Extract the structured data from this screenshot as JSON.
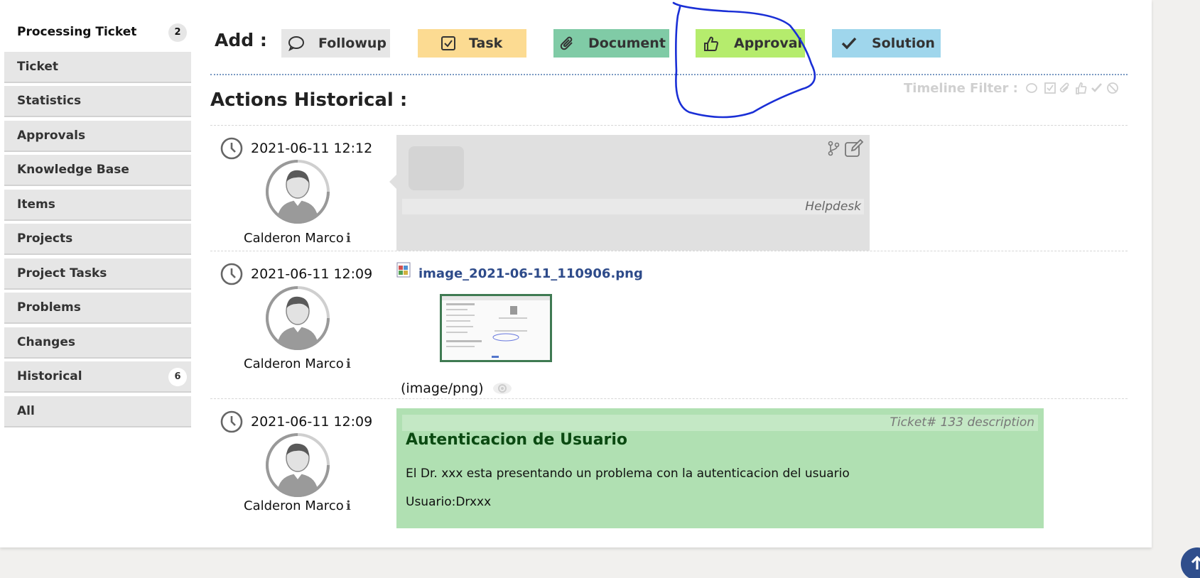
{
  "sidebar": {
    "items": [
      {
        "label": "Processing Ticket",
        "badge": "2"
      },
      {
        "label": "Ticket"
      },
      {
        "label": "Statistics"
      },
      {
        "label": "Approvals"
      },
      {
        "label": "Knowledge Base"
      },
      {
        "label": "Items"
      },
      {
        "label": "Projects"
      },
      {
        "label": "Project Tasks"
      },
      {
        "label": "Problems"
      },
      {
        "label": "Changes"
      },
      {
        "label": "Historical",
        "badge": "6"
      },
      {
        "label": "All"
      }
    ]
  },
  "add_bar": {
    "label": "Add :",
    "buttons": {
      "followup": "Followup",
      "task": "Task",
      "document": "Document",
      "approval": "Approval",
      "solution": "Solution"
    },
    "colors": {
      "followup": "#e6e6e6",
      "task": "#fcdb92",
      "document": "#80cba6",
      "approval": "#b5ec6d",
      "solution": "#9fd6ec"
    }
  },
  "timeline": {
    "title": "Actions Historical :",
    "filter_label": "Timeline Filter :",
    "filter_icons": [
      "followup-icon",
      "task-icon",
      "document-icon",
      "approval-icon",
      "solution-icon",
      "refused-icon"
    ],
    "entries": [
      {
        "date": "2021-06-11 12:12",
        "author": "Calderon Marco",
        "type": "followup",
        "source": "Helpdesk"
      },
      {
        "date": "2021-06-11 12:09",
        "author": "Calderon Marco",
        "type": "document",
        "filename": "image_2021-06-11_110906.png",
        "mime": "(image/png)"
      },
      {
        "date": "2021-06-11 12:09",
        "author": "Calderon Marco",
        "type": "description",
        "label": "Ticket# 133 description",
        "heading": "Autenticacion de Usuario",
        "line1": "El Dr. xxx esta presentando un problema con la autenticacion del usuario",
        "line2": "Usuario:Drxxx"
      }
    ]
  },
  "annotation_color": "#1a2fd6"
}
